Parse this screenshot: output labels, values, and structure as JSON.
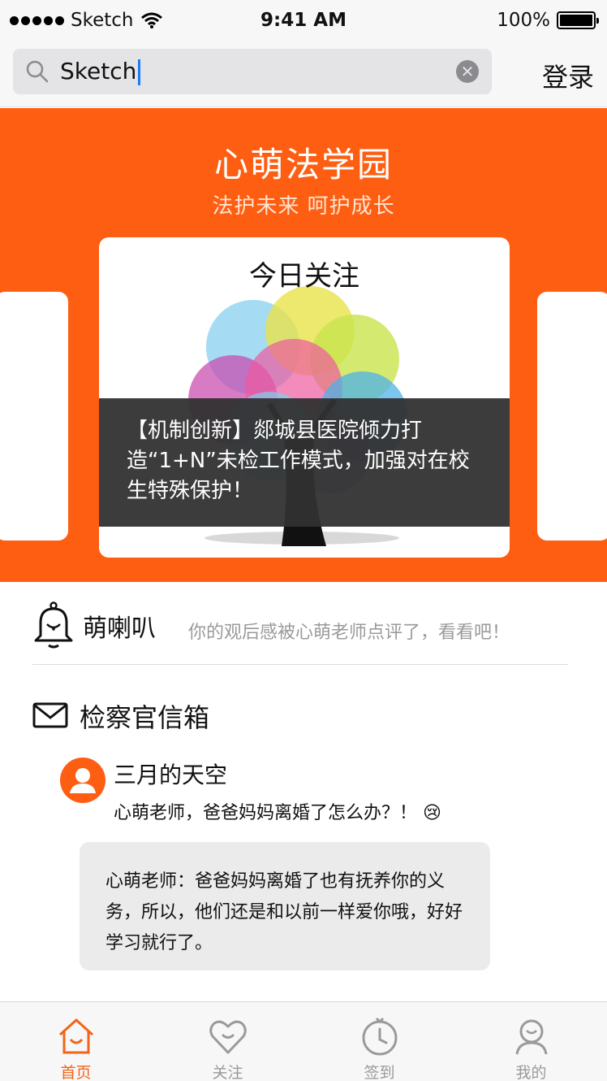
{
  "status_bar": {
    "carrier": "Sketch",
    "time": "9:41 AM",
    "battery": "100%"
  },
  "search": {
    "value": "Sketch",
    "login_label": "登录"
  },
  "banner": {
    "title": "心萌法学园",
    "subtitle": "法护未来  呵护成长",
    "card_heading": "今日关注",
    "headline": "【机制创新】郯城县医院倾力打造“1+N”未检工作模式，加强对在校生特殊保护！"
  },
  "notice": {
    "title": "萌喇叭",
    "message": "你的观后感被心萌老师点评了，看看吧！"
  },
  "mailbox": {
    "title": "检察官信箱",
    "user_name": "三月的天空",
    "question": "心萌老师，爸爸妈妈离婚了怎么办？！ 😢",
    "reply": "心萌老师：爸爸妈妈离婚了也有抚养你的义务，所以，他们还是和以前一样爱你哦，好好学习就行了。"
  },
  "tabs": [
    {
      "label": "首页",
      "icon": "home-icon",
      "active": true
    },
    {
      "label": "关注",
      "icon": "heart-icon",
      "active": false
    },
    {
      "label": "签到",
      "icon": "clock-icon",
      "active": false
    },
    {
      "label": "我的",
      "icon": "profile-icon",
      "active": false
    }
  ],
  "colors": {
    "accent": "#fe5e12",
    "tab_active": "#f26418",
    "tab_inactive": "#9a9a9a"
  }
}
